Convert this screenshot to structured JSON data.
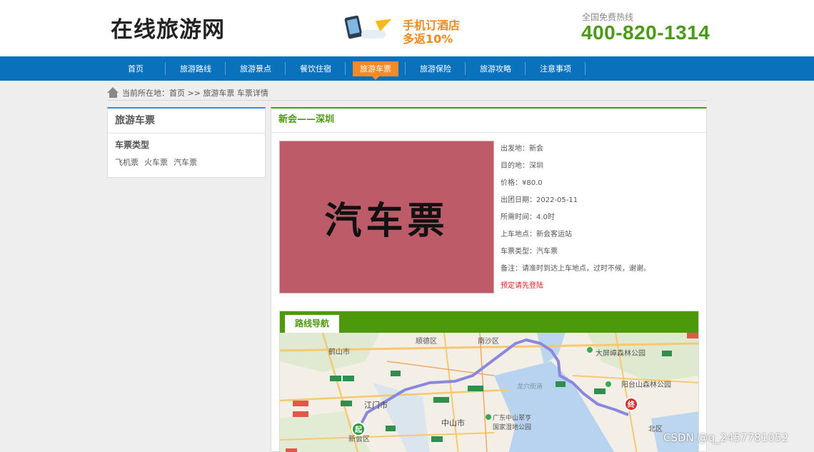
{
  "header": {
    "logo": "在线旅游网",
    "promo_line1": "手机订酒店",
    "promo_line2": "多返10%",
    "hotline_label": "全国免费热线",
    "hotline_number": "400-820-1314"
  },
  "nav": {
    "items": [
      "首页",
      "旅游路线",
      "旅游景点",
      "餐饮住宿",
      "旅游车票",
      "旅游保险",
      "旅游攻略",
      "注意事项"
    ],
    "active_index": 4
  },
  "breadcrumb": {
    "text": "当前所在地：首页 >> 旅游车票 车票详情"
  },
  "sidebar": {
    "title": "旅游车票",
    "subtitle": "车票类型",
    "links": [
      "飞机票",
      "火车票",
      "汽车票"
    ]
  },
  "ticket": {
    "title": "新会——深圳",
    "image_text": "汽车票",
    "details": [
      {
        "label": "出发地：",
        "value": "新会"
      },
      {
        "label": "目的地：",
        "value": "深圳"
      },
      {
        "label": "价格：",
        "value": "¥80.0"
      },
      {
        "label": "出团日期：",
        "value": "2022-05-11"
      },
      {
        "label": "所需时间：",
        "value": "4.0时"
      },
      {
        "label": "上车地点：",
        "value": "新会客运站"
      },
      {
        "label": "车票类型：",
        "value": "汽车票"
      },
      {
        "label": "备注：",
        "value": "请准时到达上车地点，过时不候，谢谢。"
      }
    ],
    "login_prompt": "预定请先登陆"
  },
  "route": {
    "tab_label": "路线导航",
    "map_labels": {
      "shunde": "顺德区",
      "nansha": "南沙区",
      "heshan": "鹤山市",
      "jiangmen": "江门市",
      "zhongshan": "中山市",
      "xinhui": "新会区",
      "dapingzhang": "大屏嶂森林公园",
      "yangtaishan": "阳台山森林公园",
      "wetland1": "广东中山翠亨",
      "wetland2": "国家湿地公园",
      "longxue": "龙穴街道",
      "beiqu": "北区",
      "start_marker": "起",
      "end_marker": "终"
    }
  },
  "watermark": "CSDN @q_2457781052",
  "colors": {
    "nav_bg": "#0a71bd",
    "nav_active": "#f48a28",
    "green_accent": "#4c9a0c",
    "hotline": "#4a9a16",
    "promo_orange": "#f08a1c",
    "login_red": "#e02020"
  }
}
